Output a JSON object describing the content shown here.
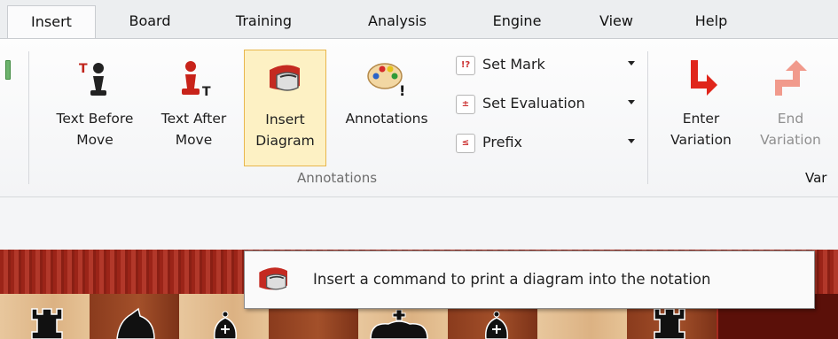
{
  "tabs": [
    {
      "label": "Insert",
      "active": true
    },
    {
      "label": "Board"
    },
    {
      "label": "Training"
    },
    {
      "label": "Analysis"
    },
    {
      "label": "Engine"
    },
    {
      "label": "View"
    },
    {
      "label": "Help"
    }
  ],
  "ribbon": {
    "annotations_group": {
      "label": "Annotations",
      "text_before_move": {
        "line1": "Text Before",
        "line2": "Move",
        "icon": "pawn-text-before-icon"
      },
      "text_after_move": {
        "line1": "Text After",
        "line2": "Move",
        "icon": "pawn-text-after-icon"
      },
      "insert_diagram": {
        "line1": "Insert",
        "line2": "Diagram",
        "icon": "diagram-icon",
        "selected": true
      },
      "annotations": {
        "line1": "Annotations",
        "icon": "palette-icon"
      },
      "set_mark": {
        "label": "Set Mark",
        "icon_text": "!?"
      },
      "set_evaluation": {
        "label": "Set Evaluation",
        "icon_text": "±"
      },
      "prefix": {
        "label": "Prefix",
        "icon_text": "≤"
      }
    },
    "variations_group": {
      "label": "Var",
      "enter_variation": {
        "line1": "Enter",
        "line2": "Variation",
        "icon": "enter-arrow-icon"
      },
      "end_variation": {
        "line1": "End",
        "line2": "Variation",
        "icon": "end-arrow-icon",
        "disabled": true
      }
    }
  },
  "tooltip": {
    "text": "Insert a command to print a diagram into the notation",
    "icon": "diagram-icon"
  },
  "colors": {
    "accent_selected": "#fdf1c4",
    "enter_arrow": "#e0261b",
    "end_arrow": "#f19a8c"
  }
}
